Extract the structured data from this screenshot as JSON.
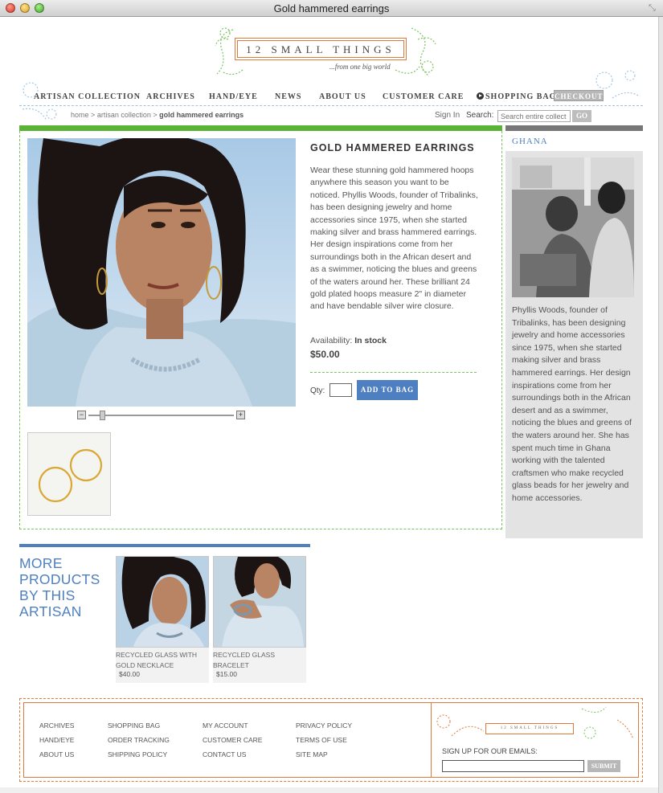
{
  "window": {
    "title": "Gold hammered earrings"
  },
  "brand": {
    "name": "12 SMALL THINGS",
    "tagline": "...from one big world",
    "accent": "#e07a3c",
    "green": "#5ab334",
    "blue": "#4e7fc1"
  },
  "nav": {
    "items": [
      "ARTISAN COLLECTION",
      "ARCHIVES",
      "HAND/EYE",
      "NEWS",
      "ABOUT US",
      "CUSTOMER CARE"
    ],
    "shopping_bag": "SHOPPING BAG",
    "checkout": "CHECKOUT"
  },
  "breadcrumb": {
    "home": "home",
    "sep": ">",
    "collection": "artisan collection",
    "current": "gold hammered earrings"
  },
  "account": {
    "sign_in": "Sign In"
  },
  "search": {
    "label": "Search:",
    "placeholder": "Search entire collect",
    "button": "GO"
  },
  "product": {
    "title": "GOLD HAMMERED EARRINGS",
    "description": "Wear these stunning gold hammered hoops anywhere this season you want to be noticed. Phyllis Woods, founder of Tribalinks, has been designing jewelry and home accessories since 1975, when she started making silver and brass hammered earrings. Her design inspirations come from her surroundings both in the African desert and as a swimmer, noticing the blues and greens of the waters around her. These brilliant 24 gold plated hoops measure 2\" in diameter and have bendable silver wire closure.",
    "availability_label": "Availability:",
    "availability": "In stock",
    "price": "$50.00",
    "qty_label": "Qty:",
    "add_button": "ADD TO BAG",
    "zoom_minus": "−",
    "zoom_plus": "+",
    "zoom_level": 0.08
  },
  "sidebar": {
    "title": "GHANA",
    "text": "Phyllis Woods, founder of Tribalinks, has been designing jewelry and home accessories since 1975, when she started making silver and brass hammered earrings. Her design inspirations come from her surroundings both in the African desert and as a swimmer, noticing the blues and greens of the waters around her. She has spent much time in Ghana working with the talented craftsmen who make recycled glass beads for her jewelry and home accessories."
  },
  "more": {
    "title": "MORE PRODUCTS BY THIS ARTISAN",
    "items": [
      {
        "name": "RECYCLED GLASS WITH GOLD NECKLACE",
        "price": "$40.00"
      },
      {
        "name": "RECYCLED GLASS BRACELET",
        "price": "$15.00"
      }
    ]
  },
  "footer": {
    "col1": [
      "ARCHIVES",
      "HAND/EYE",
      "ABOUT US"
    ],
    "col2": [
      "SHOPPING BAG",
      "ORDER TRACKING",
      "SHIPPING POLICY"
    ],
    "col3": [
      "MY ACCOUNT",
      "CUSTOMER CARE",
      "CONTACT US"
    ],
    "col4": [
      "PRIVACY POLICY",
      "TERMS OF USE",
      "SITE MAP"
    ],
    "logo": "12 SMALL THINGS",
    "signup_label": "SIGN UP FOR OUR EMAILS:",
    "submit": "SUBMIT"
  }
}
